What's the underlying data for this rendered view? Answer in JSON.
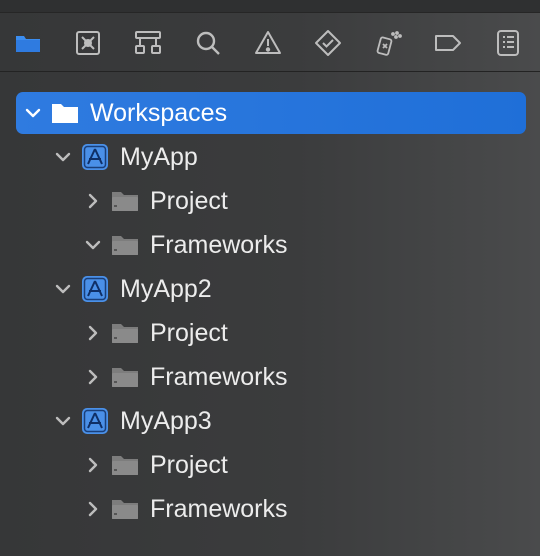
{
  "toolbar": {
    "icons": [
      {
        "name": "project-navigator-icon",
        "active": true
      },
      {
        "name": "source-control-icon",
        "active": false
      },
      {
        "name": "symbol-navigator-icon",
        "active": false
      },
      {
        "name": "search-icon",
        "active": false
      },
      {
        "name": "issues-icon",
        "active": false
      },
      {
        "name": "tests-icon",
        "active": false
      },
      {
        "name": "debug-icon",
        "active": false
      },
      {
        "name": "breakpoint-icon",
        "active": false
      },
      {
        "name": "report-icon",
        "active": false
      }
    ]
  },
  "colors": {
    "accent": "#2f7be0",
    "active_icon": "#3b8df0",
    "app_icon": "#4a90e8",
    "text": "#ececec",
    "folder": "#8a8a8a"
  },
  "tree": {
    "root_label": "Workspaces",
    "apps": [
      {
        "label": "MyApp",
        "children": [
          {
            "label": "Project",
            "expanded": false
          },
          {
            "label": "Frameworks",
            "expanded": true
          }
        ]
      },
      {
        "label": "MyApp2",
        "children": [
          {
            "label": "Project",
            "expanded": false
          },
          {
            "label": "Frameworks",
            "expanded": false
          }
        ]
      },
      {
        "label": "MyApp3",
        "children": [
          {
            "label": "Project",
            "expanded": false
          },
          {
            "label": "Frameworks",
            "expanded": false
          }
        ]
      }
    ]
  }
}
